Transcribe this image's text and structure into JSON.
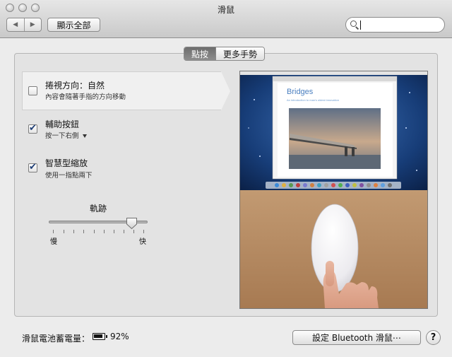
{
  "window": {
    "title": "滑鼠"
  },
  "toolbar": {
    "back_label": "◀",
    "forward_label": "▶",
    "show_all_label": "顯示全部",
    "search_placeholder": ""
  },
  "tabs": [
    {
      "label": "點按",
      "selected": true
    },
    {
      "label": "更多手勢",
      "selected": false
    }
  ],
  "options": [
    {
      "title": "捲視方向：自然",
      "description": "內容會隨著手指的方向移動",
      "checked": false
    },
    {
      "title": "輔助按鈕",
      "description": "按一下右側",
      "checked": true,
      "has_dropdown": true
    },
    {
      "title": "智慧型縮放",
      "description": "使用一指點兩下",
      "checked": true
    }
  ],
  "tracking": {
    "label": "軌跡",
    "slow_label": "慢",
    "fast_label": "快",
    "value_fraction": 0.83
  },
  "preview": {
    "slide_title": "Bridges",
    "slide_subtitle": "An introduction to man's oldest innovation"
  },
  "footer": {
    "battery_label": "滑鼠電池蓄電量：",
    "battery_percent": "92%",
    "bluetooth_button": "設定 Bluetooth 滑鼠⋯",
    "help_label": "?"
  },
  "colors": {
    "checkmark": "#1f3f76",
    "tab_selected": "#7a7a7a",
    "desktop_blue": "#1a4a8c",
    "desk_wood": "#b48a64"
  }
}
